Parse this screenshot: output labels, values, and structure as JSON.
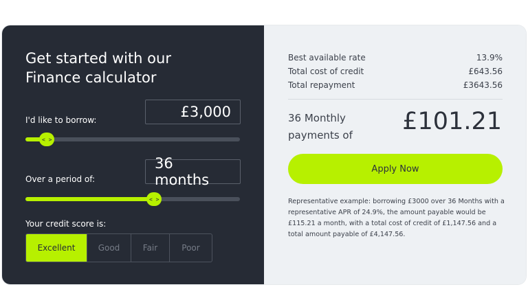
{
  "calculator": {
    "title_line1": "Get started with our",
    "title_line2": "Finance calculator",
    "borrow": {
      "label": "I'd like to borrow:",
      "value": "£3,000",
      "slider_fraction": 0.1
    },
    "period": {
      "label": "Over a period of:",
      "value": "36 months",
      "slider_fraction": 0.6
    },
    "slider_knob_glyph": "< >",
    "credit": {
      "label": "Your credit score is:",
      "options": [
        "Excellent",
        "Good",
        "Fair",
        "Poor"
      ],
      "selected": "Excellent"
    }
  },
  "summary": {
    "rows": [
      {
        "label": "Best available rate",
        "value": "13.9%"
      },
      {
        "label": "Total cost of credit",
        "value": "£643.56"
      },
      {
        "label": "Total repayment",
        "value": "£3643.56"
      }
    ],
    "monthly_label_line1": "36 Monthly",
    "monthly_label_line2": "payments of",
    "monthly_value": "£101.21",
    "apply_label": "Apply Now",
    "representative_text": "Representative example: borrowing £3000 over 36 Months with a representative APR of 24.9%, the amount payable would be £115.21 a month, with a total cost of credit of £1,147.56 and a total amount payable of £4,147.56."
  },
  "colors": {
    "accent": "#b7f000",
    "dark_panel": "#262b35",
    "light_panel": "#eef1f4"
  }
}
